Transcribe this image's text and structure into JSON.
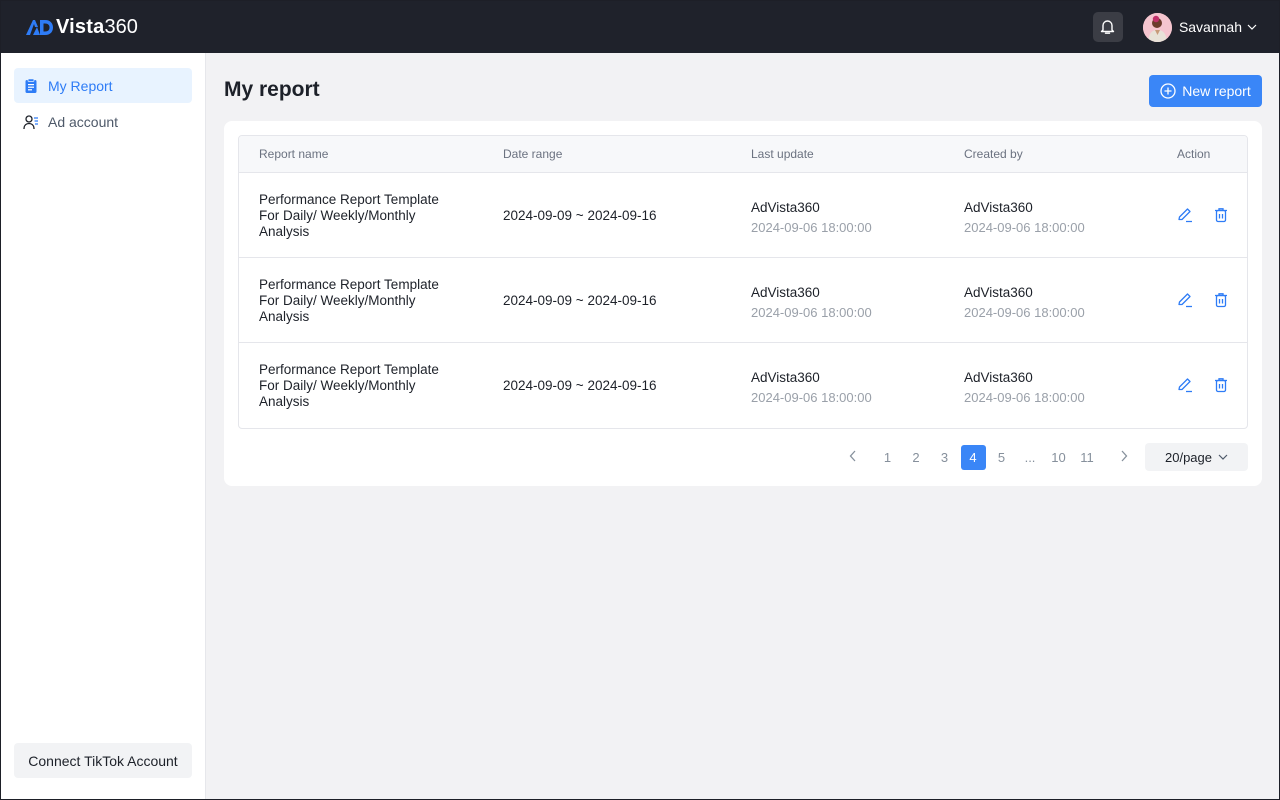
{
  "app": {
    "logo_text": "Vista",
    "logo_num": "360",
    "brand_color": "#2e7cf6"
  },
  "header": {
    "notification_icon": "bell-icon",
    "user": {
      "name": "Savannah",
      "avatar_icon": "user-avatar",
      "dropdown_icon": "chevron-down-icon"
    }
  },
  "sidebar": {
    "items": [
      {
        "label": "My Report",
        "icon": "clipboard-icon",
        "active": true
      },
      {
        "label": "Ad account",
        "icon": "user-list-icon",
        "active": false
      }
    ],
    "connect_button": "Connect TikTok Account"
  },
  "main": {
    "title": "My report",
    "new_button": "New report",
    "new_button_icon": "plus-circle-icon",
    "table": {
      "columns": [
        "Report name",
        "Date range",
        "Last update",
        "Created by",
        "Action"
      ],
      "rows": [
        {
          "name": "Performance Report Template For Daily/ Weekly/Monthly Analysis",
          "date_range": "2024-09-09 ~ 2024-09-16",
          "last_update_by": "AdVista360",
          "last_update_time": "2024-09-06 18:00:00",
          "created_by": "AdVista360",
          "created_time": "2024-09-06 18:00:00"
        },
        {
          "name": "Performance Report Template For Daily/ Weekly/Monthly Analysis",
          "date_range": "2024-09-09 ~ 2024-09-16",
          "last_update_by": "AdVista360",
          "last_update_time": "2024-09-06 18:00:00",
          "created_by": "AdVista360",
          "created_time": "2024-09-06 18:00:00"
        },
        {
          "name": "Performance Report Template For Daily/ Weekly/Monthly Analysis",
          "date_range": "2024-09-09 ~ 2024-09-16",
          "last_update_by": "AdVista360",
          "last_update_time": "2024-09-06 18:00:00",
          "created_by": "AdVista360",
          "created_time": "2024-09-06 18:00:00"
        }
      ],
      "actions": {
        "edit_icon": "edit-pencil-icon",
        "delete_icon": "trash-icon"
      }
    },
    "pagination": {
      "prev_icon": "chevron-left-icon",
      "next_icon": "chevron-right-icon",
      "pages": [
        "1",
        "2",
        "3",
        "4",
        "5",
        "...",
        "10",
        "11"
      ],
      "current": "4",
      "page_size": "20/page"
    }
  }
}
